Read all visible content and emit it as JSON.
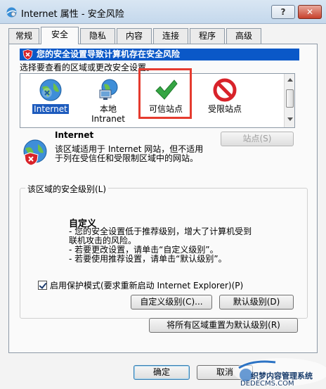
{
  "window": {
    "title": "Internet 属性 - 安全风险",
    "help_label": "?",
    "close_label": "✕"
  },
  "tabs": [
    {
      "label": "常规"
    },
    {
      "label": "安全"
    },
    {
      "label": "隐私"
    },
    {
      "label": "内容"
    },
    {
      "label": "连接"
    },
    {
      "label": "程序"
    },
    {
      "label": "高级"
    }
  ],
  "security": {
    "warning": "您的安全设置导致计算机存在安全风险",
    "select_prompt": "选择要查看的区域或更改安全设置。",
    "zones": [
      {
        "label": "Internet"
      },
      {
        "label": "本地",
        "label2": "Intranet"
      },
      {
        "label": "可信站点"
      },
      {
        "label": "受限站点"
      }
    ],
    "sites_button": "站点(S)",
    "info_title": "Internet",
    "info_desc": "该区域适用于 Internet 网站，但不适用于列在受信任和受限制区域中的网站。",
    "level_group_title": "该区域的安全级别(L)",
    "level_title": "自定义",
    "level_lines": [
      "- 您的安全设置低于推荐级别，增大了计算机受到",
      "联机攻击的风险。",
      "- 若要更改设置，请单击“自定义级别”。",
      "- 若要使用推荐设置，请单击“默认级别”。"
    ],
    "protected_mode": "启用保护模式(要求重新启动 Internet Explorer)(P)",
    "custom_level_button": "自定义级别(C)...",
    "default_level_button": "默认级别(D)",
    "reset_all_button": "将所有区域重置为默认级别(R)"
  },
  "footer": {
    "ok_label": "确定",
    "cancel_label": "取消"
  },
  "watermark": {
    "line1": "织梦内容管理系统",
    "line2": "DEDECMS.COM"
  }
}
